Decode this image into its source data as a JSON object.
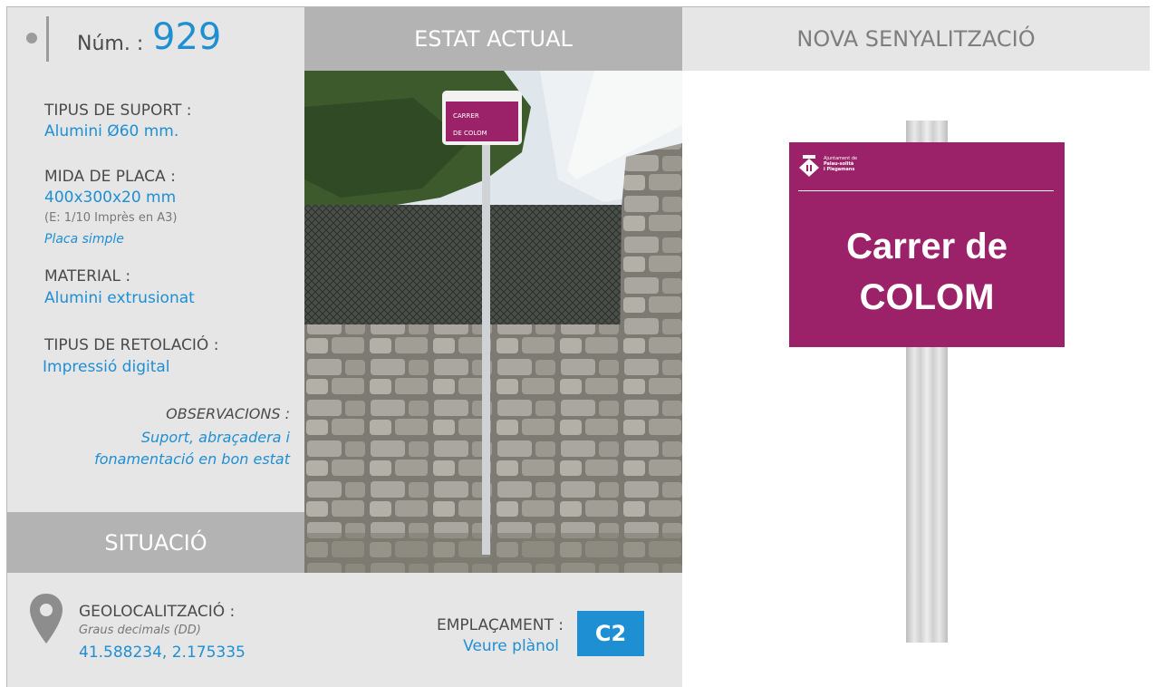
{
  "header": {
    "num_label": "Núm. :",
    "num_value": "929",
    "current_state": "ESTAT ACTUAL",
    "new_signage": "NOVA SENYALITZACIÓ"
  },
  "specs": {
    "support_label": "TIPUS DE SUPORT :",
    "support_value": "Alumini Ø60 mm.",
    "plate_label": "MIDA DE PLACA :",
    "plate_value": "400x300x20 mm",
    "plate_scale": "(E: 1/10 Imprès en A3)",
    "plate_type": "Placa simple",
    "material_label": "MATERIAL :",
    "material_value": "Alumini extrusionat",
    "lettering_label": "TIPUS DE RETOLACIÓ :",
    "lettering_value": "Impressió digital",
    "observations_label": "OBSERVACIONS :",
    "observations_line1": "Suport, abraçadera i",
    "observations_line2": "fonamentació en bon estat"
  },
  "situation": {
    "title": "SITUACIÓ",
    "geo_label": "GEOLOCALITZACIÓ :",
    "geo_format": "Graus decimals (DD)",
    "geo_value": "41.588234, 2.175335",
    "location_label": "EMPLAÇAMENT :",
    "location_link": "Veure plànol",
    "location_code": "C2"
  },
  "photo_sign": {
    "line1": "CARRER",
    "line2": "DE COLOM"
  },
  "new_sign": {
    "logo_line1": "Ajuntament de",
    "logo_line2": "Palau-solità",
    "logo_line3": "i Plegamans",
    "line1": "Carrer de",
    "line2": "COLOM"
  },
  "colors": {
    "accent_blue": "#1f8fd3",
    "sign_magenta": "#9b2268",
    "panel_grey": "#e6e6e6",
    "header_grey": "#b3b3b3"
  },
  "icons": [
    "location-pin-icon",
    "municipal-shield-icon"
  ]
}
